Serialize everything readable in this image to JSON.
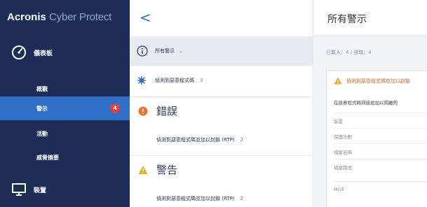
{
  "sidebar": {
    "brand_bold": "Acronis",
    "brand_light": "Cyber Protect",
    "dashboard_label": "儀表板",
    "items": [
      {
        "label": "概觀"
      },
      {
        "label": "警示",
        "badge": "4"
      },
      {
        "label": "活動"
      },
      {
        "label": "威脅摘要"
      }
    ],
    "devices_label": "裝置"
  },
  "middle": {
    "back_label": "<",
    "filter_label": "所有警示",
    "filter_chevron": "⌄",
    "first_item": {
      "text": "偵測到惡意程式碼",
      "count": "3"
    },
    "error_section": {
      "title": "錯誤",
      "item_text": "偵測到惡意程式碼並加以封鎖 (RTP)",
      "count": "2"
    },
    "warning_section": {
      "title": "警告",
      "item_text": "偵測到惡意程式碼並加以封鎖 (RTP)",
      "count": "2"
    }
  },
  "right": {
    "title": "所有警示",
    "selected_text": "已載入：4 / 選取：4",
    "card": {
      "title": "偵測到惡意程式碼並加以封鎖",
      "description": "在惡意程式碼掃描並加以隔離的",
      "fields": [
        "裝置",
        "保護計劃",
        "檔案名稱",
        "檔案路徑",
        "MD5"
      ]
    }
  },
  "colors": {
    "sidebar_bg": "#1d2d56",
    "active_bg": "#2f6fc8",
    "badge": "#e5413a",
    "error": "#e8762c",
    "warning": "#f0a81e",
    "accent": "#2f6fc8"
  }
}
